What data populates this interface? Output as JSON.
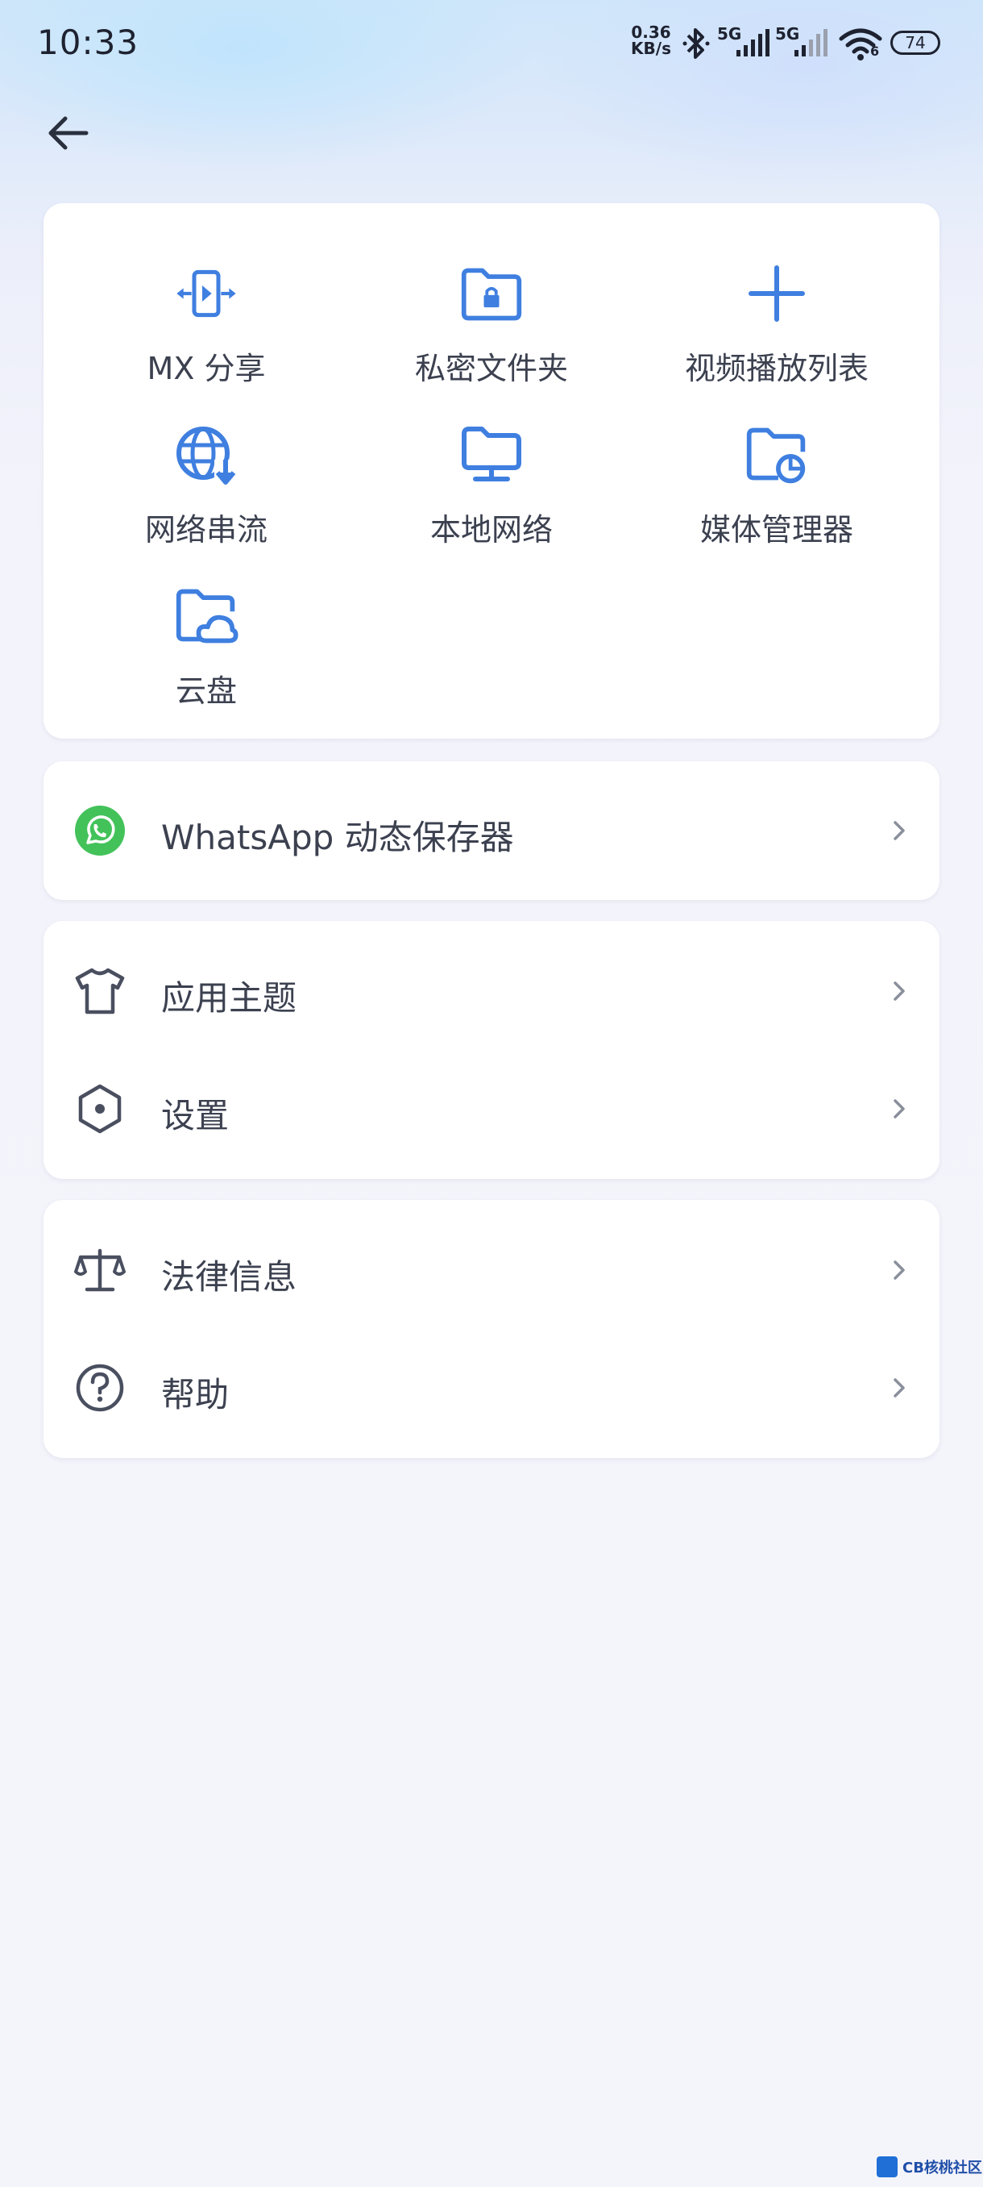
{
  "status_bar": {
    "time": "10:33",
    "net_speed_value": "0.36",
    "net_speed_unit": "KB/s",
    "signal1_label": "5G",
    "signal2_label": "5G",
    "wifi_number": "6",
    "battery": "74"
  },
  "grid": {
    "items": [
      {
        "label": "MX 分享",
        "icon": "mx-share-icon"
      },
      {
        "label": "私密文件夹",
        "icon": "private-folder-icon"
      },
      {
        "label": "视频播放列表",
        "icon": "plus-icon"
      },
      {
        "label": "网络串流",
        "icon": "network-stream-icon"
      },
      {
        "label": "本地网络",
        "icon": "local-network-icon"
      },
      {
        "label": "媒体管理器",
        "icon": "media-manager-icon"
      },
      {
        "label": "云盘",
        "icon": "cloud-drive-icon"
      }
    ]
  },
  "whatsapp": {
    "label": "WhatsApp 动态保存器",
    "icon": "whatsapp-icon"
  },
  "settings_group": [
    {
      "label": "应用主题",
      "icon": "tshirt-icon"
    },
    {
      "label": "设置",
      "icon": "settings-hexagon-icon"
    }
  ],
  "info_group": [
    {
      "label": "法律信息",
      "icon": "scale-icon"
    },
    {
      "label": "帮助",
      "icon": "help-icon"
    }
  ],
  "colors": {
    "accent": "#3f7fe0",
    "whatsapp": "#43c25a",
    "icon_gray": "#4a4f60"
  },
  "watermark": "CB核桃社区"
}
